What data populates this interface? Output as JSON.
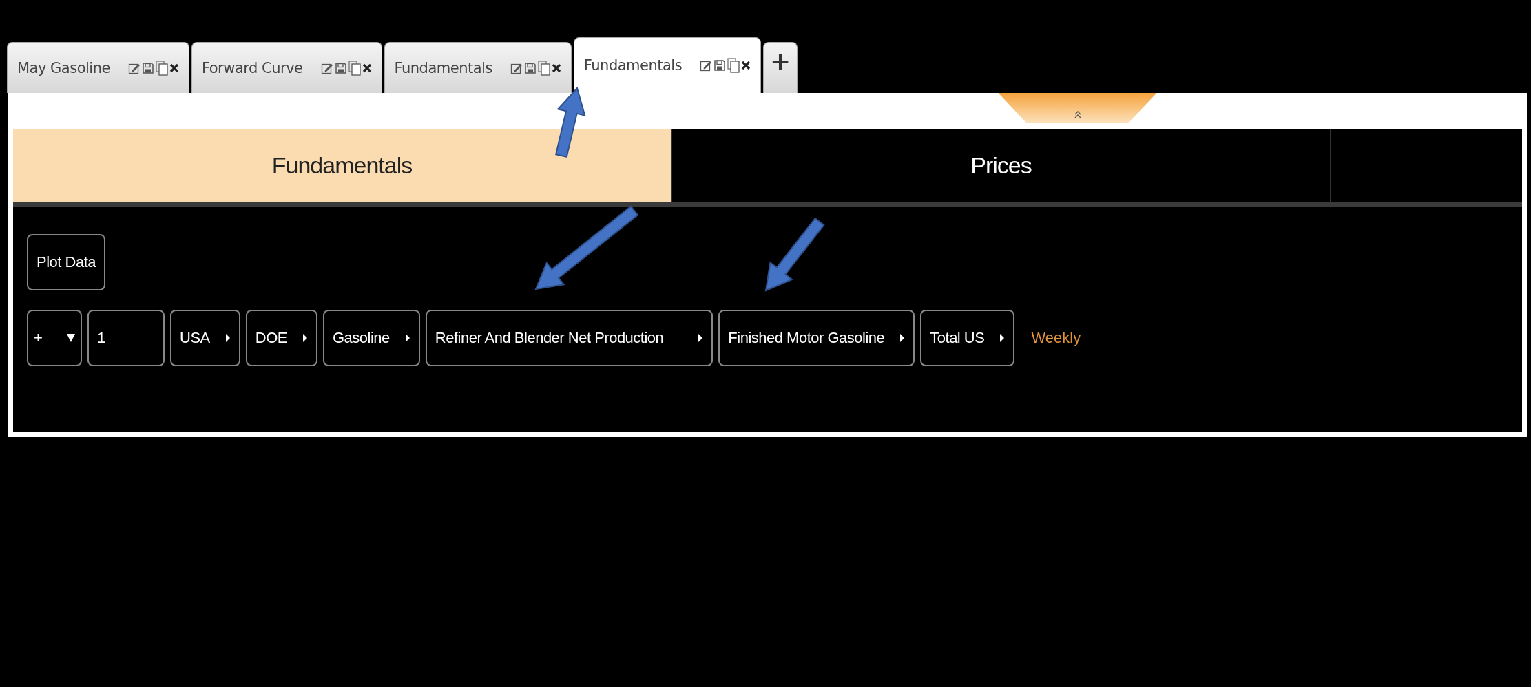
{
  "tabs": [
    {
      "label": "May Gasoline",
      "selected": false
    },
    {
      "label": "Forward Curve",
      "selected": false
    },
    {
      "label": "Fundamentals",
      "selected": false
    },
    {
      "label": "Fundamentals",
      "selected": true
    }
  ],
  "add_tab": "+",
  "segments": [
    {
      "label": "Fundamentals",
      "selected": true
    },
    {
      "label": "Prices",
      "selected": false
    }
  ],
  "plot_button": "Plot Data",
  "query": {
    "operator": "+",
    "input_value": "1",
    "path": [
      "USA",
      "DOE",
      "Gasoline",
      "Refiner And Blender Net Production",
      "Finished Motor Gasoline",
      "Total US"
    ],
    "frequency": "Weekly"
  }
}
